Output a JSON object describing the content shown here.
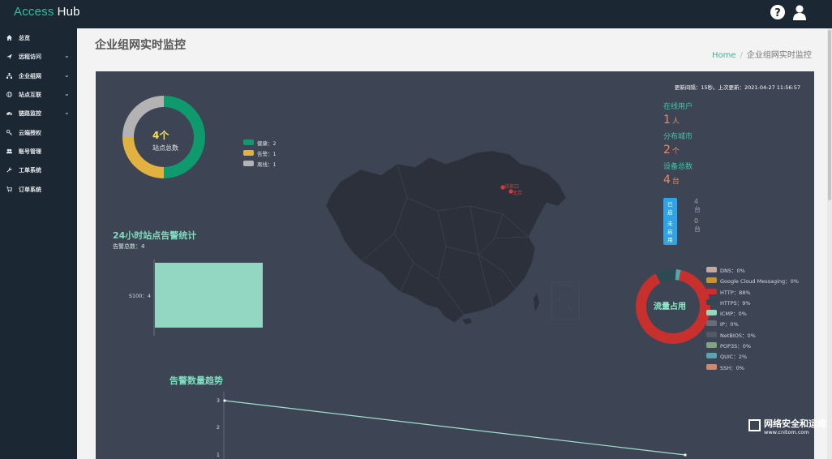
{
  "app": {
    "brand_a": "Access",
    "brand_b": "Hub"
  },
  "topbar": {
    "help_icon": "question-circle-icon",
    "user_icon": "user-icon"
  },
  "sidebar": {
    "items": [
      {
        "label": "总览",
        "icon": "home-icon",
        "expandable": false
      },
      {
        "label": "远程访问",
        "icon": "plane-icon",
        "expandable": true
      },
      {
        "label": "企业组网",
        "icon": "sitemap-icon",
        "expandable": true
      },
      {
        "label": "站点互联",
        "icon": "globe-icon",
        "expandable": true
      },
      {
        "label": "链路监控",
        "icon": "dashboard-icon",
        "expandable": true
      },
      {
        "label": "云端授权",
        "icon": "key-icon",
        "expandable": false
      },
      {
        "label": "账号管理",
        "icon": "users-icon",
        "expandable": false
      },
      {
        "label": "工单系统",
        "icon": "wrench-icon",
        "expandable": false
      },
      {
        "label": "订单系统",
        "icon": "cart-icon",
        "expandable": false
      }
    ],
    "chevron": "⌄"
  },
  "page": {
    "title": "企业组网实时监控",
    "breadcrumb": {
      "home": "Home",
      "sep": "/",
      "current": "企业组网实时监控"
    }
  },
  "panel": {
    "update_text": "更新间隔：15秒。上次更新：2021-04-27 11:56:57",
    "site_ring": {
      "center_num": "4个",
      "center_label": "站点总数",
      "legend": [
        {
          "label": "健康：2",
          "color": "#0e9a6c"
        },
        {
          "label": "告警：1",
          "color": "#e2b241"
        },
        {
          "label": "离线：1",
          "color": "#b3b3b3"
        }
      ],
      "values": [
        2,
        1,
        1
      ]
    },
    "stats": {
      "online_users_label": "在线用户",
      "online_users": "1",
      "online_users_unit": "人",
      "cities_label": "分布城市",
      "cities": "2",
      "cities_unit": "个",
      "devices_label": "设备总数",
      "devices": "4",
      "devices_unit": "台",
      "enabled_tag": "已启用",
      "enabled_val": "4台",
      "disabled_tag": "未启用",
      "disabled_val": "0台"
    },
    "map": {
      "city_labels": [
        "张家口",
        "北京"
      ],
      "marker_color": "#d63a3a"
    },
    "alarm24": {
      "title": "24小时站点告警统计",
      "sub": "告警总数：4",
      "bar_label": "S100：4",
      "value": 4
    },
    "traffic": {
      "center_label": "流量占用",
      "legend": [
        {
          "label": "DNS：0%",
          "color": "#c4a9a0"
        },
        {
          "label": "Google Cloud Messaging：0%",
          "color": "#c9912f"
        },
        {
          "label": "HTTP：88%",
          "color": "#c7302d"
        },
        {
          "label": "HTTPS：9%",
          "color": "#2c4a52"
        },
        {
          "label": "ICMP：0%",
          "color": "#96d8bc"
        },
        {
          "label": "IP：0%",
          "color": "#676c77"
        },
        {
          "label": "NetBIOS：0%",
          "color": "#535a66"
        },
        {
          "label": "POP3S：0%",
          "color": "#7fa583"
        },
        {
          "label": "QUIC：2%",
          "color": "#5aa3ae"
        },
        {
          "label": "SSH：0%",
          "color": "#d3876c"
        }
      ],
      "values": [
        0,
        0,
        88,
        9,
        0,
        0,
        0,
        0,
        2,
        0
      ]
    },
    "trend": {
      "title": "告警数量趋势",
      "ticks": [
        "3",
        "2",
        "1"
      ],
      "points": [
        3,
        1
      ]
    }
  },
  "watermark": {
    "line1": "网络安全和运维",
    "line2": "www.cnitom.com"
  }
}
